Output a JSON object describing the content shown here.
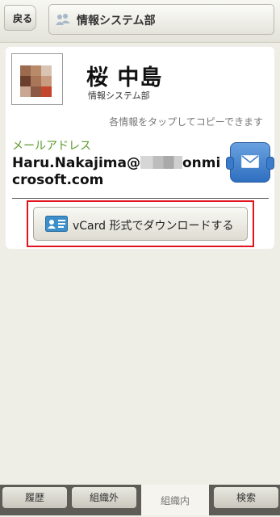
{
  "header": {
    "back_label": "戻る",
    "department_title": "情報システム部",
    "department_icon": "people-icon"
  },
  "profile": {
    "name": "桜 中島",
    "department": "情報システム部",
    "copy_hint": "各情報をタップしてコピーできます",
    "email_label": "メールアドレス",
    "email_prefix": "Haru.Nakajima@",
    "email_suffix": "onmicrosoft.com",
    "vcard_label": "vCard 形式でダウンロードする"
  },
  "tabs": [
    {
      "label": "履歴",
      "active": false
    },
    {
      "label": "組織外",
      "active": false
    },
    {
      "label": "組織内",
      "active": true
    },
    {
      "label": "検索",
      "active": false
    }
  ],
  "colors": {
    "email_label": "#5c9b2c",
    "mail_button": "#2f6fc0",
    "highlight": "#e0141e"
  }
}
